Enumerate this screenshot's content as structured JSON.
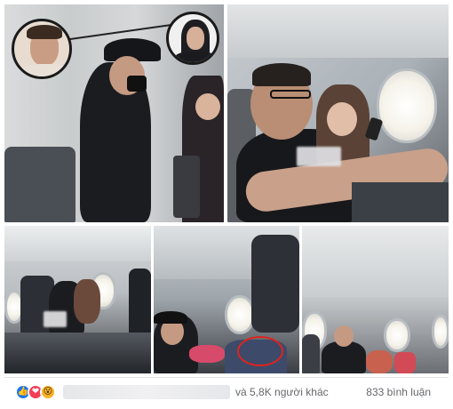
{
  "post": {
    "reactions": {
      "icons": [
        "like-icon",
        "love-icon",
        "wow-icon"
      ],
      "others_text": "và 5,8K người khác",
      "comments_text": "833 bình luận"
    }
  },
  "colors": {
    "like": "#1877f2",
    "love": "#f33e58",
    "wow": "#f7b125",
    "meta_text": "#65676b"
  }
}
